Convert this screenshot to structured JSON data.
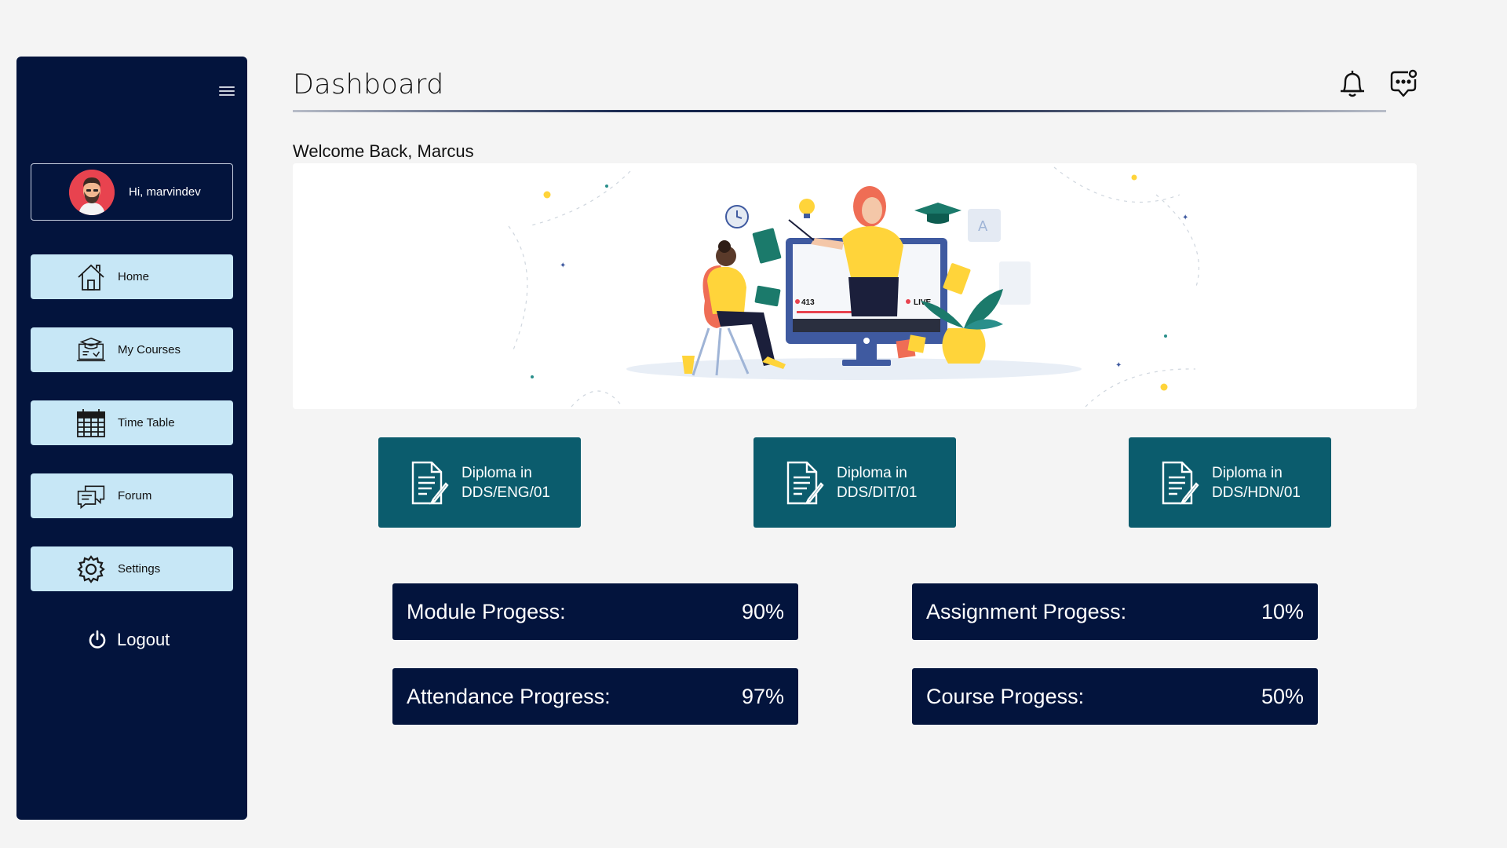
{
  "sidebar": {
    "user_greeting": "Hi, marvindev",
    "nav": [
      {
        "label": "Home",
        "icon": "home-icon"
      },
      {
        "label": "My Courses",
        "icon": "courses-icon"
      },
      {
        "label": "Time Table",
        "icon": "calendar-icon"
      },
      {
        "label": "Forum",
        "icon": "chat-icon"
      },
      {
        "label": "Settings",
        "icon": "gear-icon"
      }
    ],
    "logout_label": "Logout"
  },
  "header": {
    "title": "Dashboard",
    "icons": [
      "bell-icon",
      "message-icon"
    ]
  },
  "welcome_text": "Welcome Back, Marcus",
  "banner": {
    "viewers": "413",
    "live_label": "LIVE"
  },
  "diplomas": [
    {
      "line1": "Diploma in",
      "line2": "DDS/ENG/01"
    },
    {
      "line1": "Diploma in",
      "line2": "DDS/DIT/01"
    },
    {
      "line1": "Diploma in",
      "line2": "DDS/HDN/01"
    }
  ],
  "progress": [
    {
      "label": "Module Progess:",
      "value": "90%"
    },
    {
      "label": "Assignment Progess:",
      "value": "10%"
    },
    {
      "label": "Attendance Progress:",
      "value": "97%"
    },
    {
      "label": "Course Progess:",
      "value": "50%"
    }
  ],
  "colors": {
    "sidebar_bg": "#03143d",
    "nav_bg": "#c7e7f6",
    "diploma_bg": "#0b5c6d",
    "progress_bg": "#03143d",
    "page_bg": "#f4f4f4"
  }
}
